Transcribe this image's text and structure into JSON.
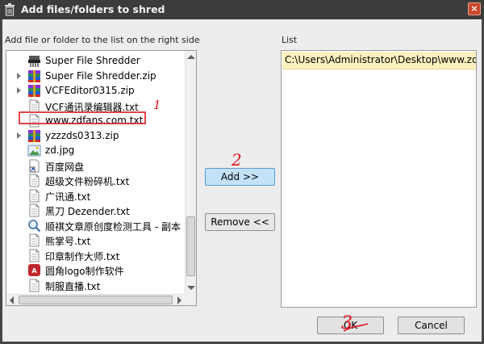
{
  "window": {
    "title": "Add files/folders to shred",
    "close_glyph": "×"
  },
  "left_panel": {
    "label": "Add file or folder to the list on the right side",
    "items": [
      {
        "label": "Super File Shredder",
        "icon": "shredder-app-icon",
        "expandable": false
      },
      {
        "label": "Super File Shredder.zip",
        "icon": "winrar-archive-icon",
        "expandable": true
      },
      {
        "label": "VCFEditor0315.zip",
        "icon": "winrar-archive-icon",
        "expandable": true
      },
      {
        "label": "VCF通讯录编辑器.txt",
        "icon": "text-file-icon",
        "expandable": false
      },
      {
        "label": "www.zdfans.com.txt",
        "icon": "text-file-icon",
        "expandable": false
      },
      {
        "label": "yzzzds0313.zip",
        "icon": "winrar-archive-icon",
        "expandable": true
      },
      {
        "label": "zd.jpg",
        "icon": "image-file-icon",
        "expandable": false
      },
      {
        "label": "百度网盘",
        "icon": "shortcut-file-icon",
        "expandable": false
      },
      {
        "label": "超级文件粉碎机.txt",
        "icon": "text-file-icon",
        "expandable": false
      },
      {
        "label": "广讯通.txt",
        "icon": "text-file-icon",
        "expandable": false
      },
      {
        "label": "黑刀 Dezender.txt",
        "icon": "text-file-icon",
        "expandable": false
      },
      {
        "label": "顺祺文章原创度检测工具 - 副本",
        "icon": "search-tool-icon",
        "expandable": false
      },
      {
        "label": "熊掌号.txt",
        "icon": "text-file-icon",
        "expandable": false
      },
      {
        "label": "印章制作大师.txt",
        "icon": "text-file-icon",
        "expandable": false
      },
      {
        "label": "圆角logo制作软件",
        "icon": "logo-app-icon",
        "expandable": false
      },
      {
        "label": "制服直播.txt",
        "icon": "text-file-icon",
        "expandable": false
      }
    ]
  },
  "right_panel": {
    "label": "List",
    "items": [
      "C:\\Users\\Administrator\\Desktop\\www.zdfans.com"
    ]
  },
  "buttons": {
    "add": "Add >>",
    "remove": "Remove <<",
    "ok": "OK",
    "cancel": "Cancel"
  },
  "annotations": {
    "step1": "1",
    "step2": "2",
    "step3": "3",
    "color": "#e0141e"
  },
  "colors": {
    "selected_item_bg": "#fcf1bf",
    "primary_button_bg": "#c4e2f7",
    "titlebar_bg": "#3c3c3c"
  }
}
